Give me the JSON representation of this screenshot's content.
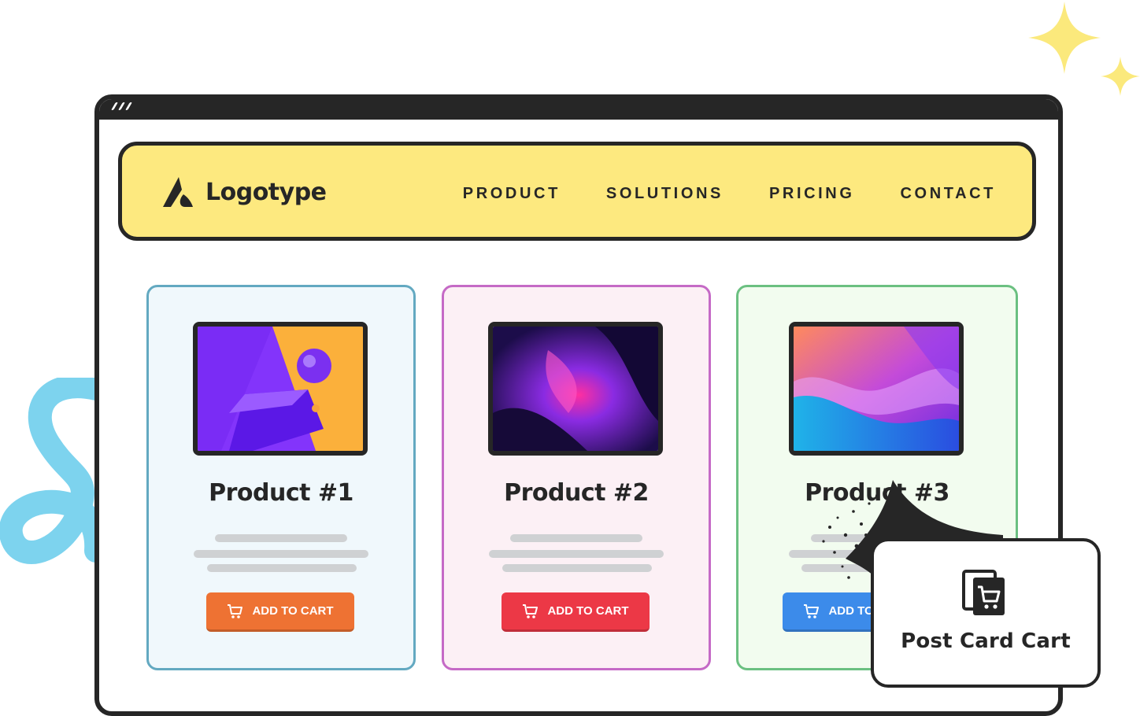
{
  "header": {
    "logo_text": "Logotype",
    "nav": [
      "PRODUCT",
      "SOLUTIONS",
      "PRICING",
      "CONTACT"
    ]
  },
  "products": [
    {
      "title": "Product #1",
      "button_label": "ADD TO CART",
      "button_color": "#ee7233",
      "border_color": "#63a9c1"
    },
    {
      "title": "Product #2",
      "button_label": "ADD TO CART",
      "button_color": "#ec3846",
      "border_color": "#c56ac6"
    },
    {
      "title": "Product #3",
      "button_label": "ADD TO CART",
      "button_color": "#3c8bea",
      "border_color": "#6bc081"
    }
  ],
  "popup": {
    "label": "Post Card Cart",
    "icon": "cart-card-icon"
  },
  "colors": {
    "navbar_bg": "#fde97f",
    "frame": "#262626",
    "sparkle": "#fbe97c",
    "squiggle": "#7dd3ee"
  }
}
